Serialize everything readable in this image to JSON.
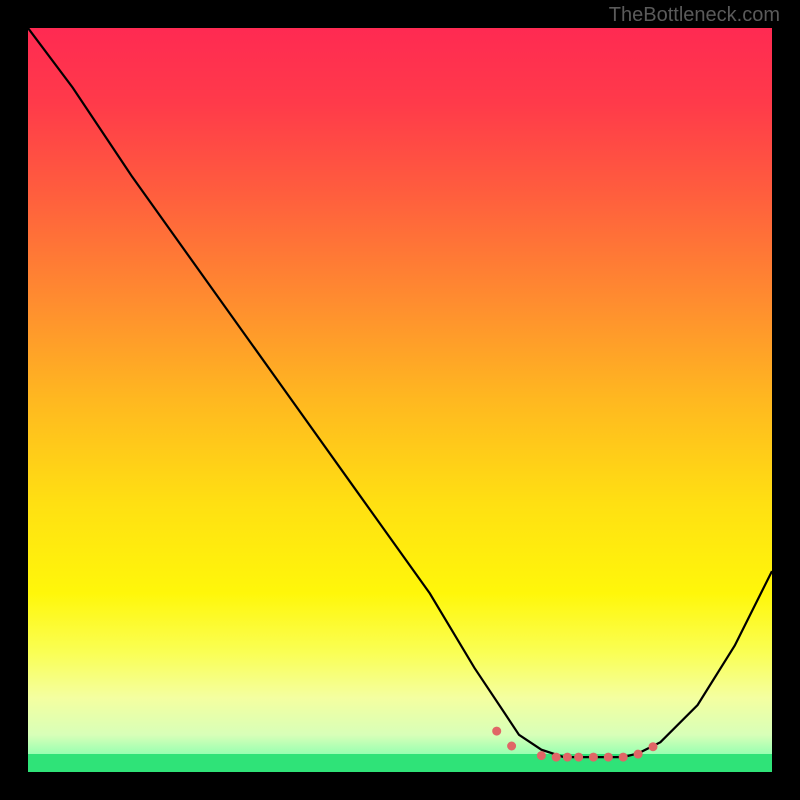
{
  "watermark": "TheBottleneck.com",
  "chart_data": {
    "type": "line",
    "title": "",
    "xlabel": "",
    "ylabel": "",
    "xlim": [
      0,
      100
    ],
    "ylim": [
      0,
      100
    ],
    "series": [
      {
        "name": "bottleneck-curve",
        "x": [
          0,
          6,
          14,
          24,
          34,
          44,
          54,
          60,
          64,
          66,
          69,
          72,
          74,
          76,
          78,
          80,
          82,
          85,
          90,
          95,
          100
        ],
        "y": [
          100,
          92,
          80,
          66,
          52,
          38,
          24,
          14,
          8,
          5,
          3,
          2,
          2,
          2,
          2,
          2,
          2.5,
          4,
          9,
          17,
          27
        ]
      }
    ],
    "markers": {
      "name": "sweet-spot-points",
      "x": [
        63,
        65,
        69,
        71,
        72.5,
        74,
        76,
        78,
        80,
        82,
        84
      ],
      "y": [
        5.5,
        3.5,
        2.2,
        2,
        2,
        2,
        2,
        2,
        2,
        2.4,
        3.4
      ]
    },
    "colors": {
      "curve": "#000000",
      "markers": "#e06666",
      "gradient_top": "#ff2a52",
      "gradient_bottom": "#2fe378"
    }
  }
}
